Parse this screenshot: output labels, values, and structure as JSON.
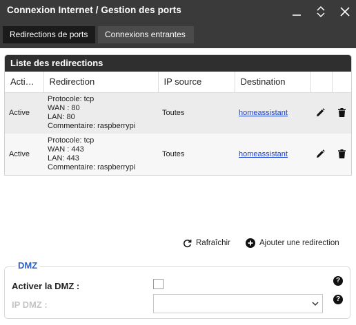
{
  "window": {
    "title": "Connexion Internet / Gestion des ports"
  },
  "tabs": [
    {
      "label": "Redirections de ports",
      "active": true
    },
    {
      "label": "Connexions entrantes",
      "active": false
    }
  ],
  "list": {
    "title": "Liste des redirections",
    "columns": [
      "Acti…",
      "Redirection",
      "IP source",
      "Destination"
    ],
    "rows": [
      {
        "status": "Active",
        "redirection": [
          "Protocole: tcp",
          "WAN : 80",
          "LAN: 80",
          "Commentaire: raspberrypi"
        ],
        "ip_source": "Toutes",
        "destination": "homeassistant"
      },
      {
        "status": "Active",
        "redirection": [
          "Protocole: tcp",
          "WAN : 443",
          "LAN: 443",
          "Commentaire: raspberrypi"
        ],
        "ip_source": "Toutes",
        "destination": "homeassistant"
      }
    ]
  },
  "actions": {
    "refresh_label": "Rafraîchir",
    "add_label": "Ajouter une redirection"
  },
  "dmz": {
    "legend": "DMZ",
    "enable_label": "Activer la DMZ :",
    "enabled": false,
    "ip_label": "IP DMZ :",
    "ip_value": ""
  },
  "colors": {
    "titlebar": "#3a3a3a",
    "tab_active": "#1b1b1b",
    "list_header": "#2f2f2f",
    "accent": "#2b62c8",
    "link": "#1a3fd0"
  }
}
